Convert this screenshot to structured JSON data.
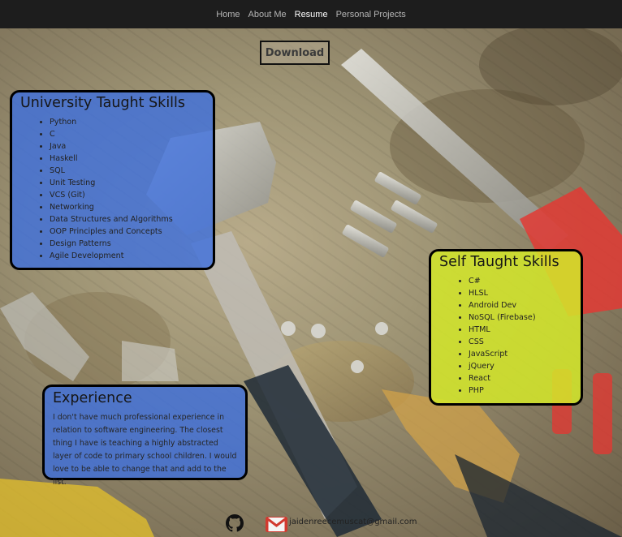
{
  "nav": {
    "links": [
      {
        "label": "Home"
      },
      {
        "label": "About Me"
      },
      {
        "label": "Resume"
      },
      {
        "label": "Personal Projects"
      }
    ],
    "active_index": 2
  },
  "download": {
    "label": "Download"
  },
  "university": {
    "title": "University Taught Skills",
    "items": [
      "Python",
      "C",
      "Java",
      "Haskell",
      "SQL",
      "Unit Testing",
      "VCS (Git)",
      "Networking",
      "Data Structures and Algorithms",
      "OOP Principles and Concepts",
      "Design Patterns",
      "Agile Development"
    ]
  },
  "self_taught": {
    "title": "Self Taught Skills",
    "items": [
      "C#",
      "HLSL",
      "Android Dev",
      "NoSQL (Firebase)",
      "HTML",
      "CSS",
      "JavaScript",
      "jQuery",
      "React",
      "PHP"
    ]
  },
  "experience": {
    "title": "Experience",
    "text": "I don't have much professional experience in relation to software engineering. The closest thing I have is teaching a highly abstracted layer of code to primary school children. I would love to be able to change that and add to the list."
  },
  "footer": {
    "github_icon": "github-icon",
    "mail_icon": "gmail-icon",
    "email": "jaidenreecemuscat@gmail.com"
  },
  "colors": {
    "navbar": "#1d1d1d",
    "card_blue": "#3f70dc",
    "card_yellow": "#d4e82a"
  }
}
